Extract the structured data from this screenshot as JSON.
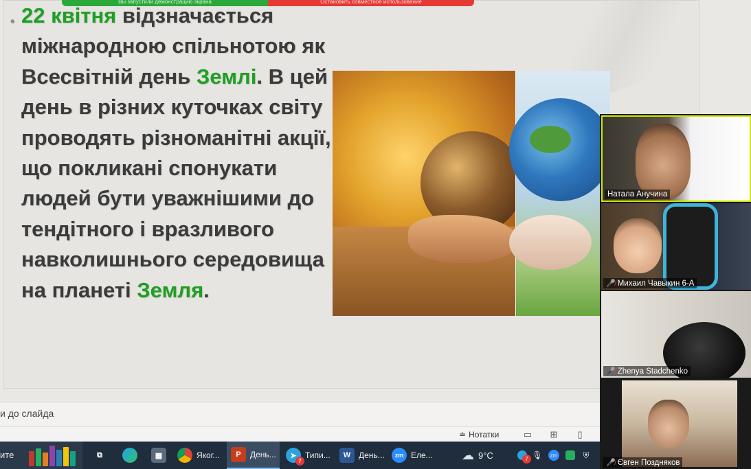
{
  "share_bar": {
    "left_text": "Вы запустили демонстрацию экрана",
    "right_text": "Остановить совместное использование"
  },
  "slide": {
    "bullet": "•",
    "parts": [
      {
        "text": "22 квітня",
        "highlight": true
      },
      {
        "text": " відзначається міжнародною спільнотою як Всесвітній день ",
        "highlight": false
      },
      {
        "text": "Землі",
        "highlight": true
      },
      {
        "text": ". В цей день в різних куточках світу проводять різноманітні акції, що покликані спонукати людей бути уважнішими до тендітного і вразливого навколишнього середовища на планеті ",
        "highlight": false
      },
      {
        "text": "Земля",
        "highlight": true
      },
      {
        "text": ".",
        "highlight": false
      }
    ],
    "highlight_color": "#1f9f24",
    "image": "earth-in-hands-image"
  },
  "notes": {
    "placeholder": "и до слайда"
  },
  "status_bar": {
    "notes_label": "Нотатки",
    "views": [
      "normal-view-icon",
      "slide-sorter-icon",
      "reading-view-icon"
    ]
  },
  "participants": [
    {
      "name": "Натала Анучина",
      "muted": false,
      "active": true
    },
    {
      "name": "Михаил Чавыкин 6-А",
      "muted": true,
      "active": false
    },
    {
      "name": "Zhenya Stadchenko",
      "muted": true,
      "active": false
    },
    {
      "name": "Євген Поздняков",
      "muted": true,
      "active": false
    }
  ],
  "taskbar": {
    "search_text": "ите",
    "items": [
      {
        "label": "",
        "icon": "task-view-icon"
      },
      {
        "label": "",
        "icon": "edge-icon"
      },
      {
        "label": "",
        "icon": "calculator-icon"
      },
      {
        "label": "Яког...",
        "icon": "chrome-icon"
      },
      {
        "label": "День...",
        "icon": "powerpoint-icon",
        "active": true
      },
      {
        "label": "Типи...",
        "icon": "telegram-icon",
        "badge": "7"
      },
      {
        "label": "День...",
        "icon": "word-icon"
      },
      {
        "label": "Еле...",
        "icon": "zoom-icon"
      }
    ],
    "weather": "9°C",
    "tray_badge": "7"
  }
}
